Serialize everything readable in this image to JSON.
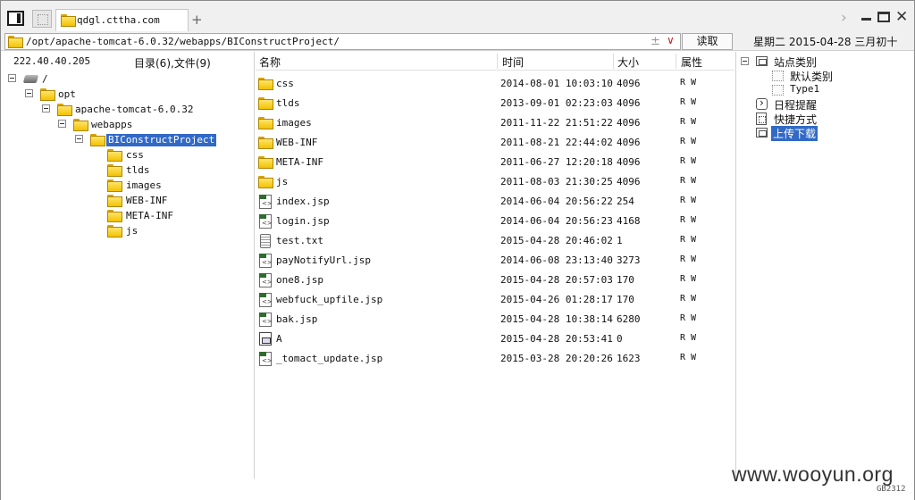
{
  "tab": {
    "title": "qdgl.cttha.com",
    "new_tab": "+"
  },
  "window_controls": {
    "forward": "›",
    "close": "✕"
  },
  "address": {
    "path": "/opt/apache-tomcat-6.0.32/webapps/BIConstructProject/",
    "star": "±",
    "dropdown": "∨"
  },
  "read_button": "读取",
  "date": "星期二 2015-04-28 三月初十",
  "tree": {
    "ip": "222.40.40.205",
    "counts": "目录(6),文件(9)",
    "nodes": [
      {
        "label": "/",
        "icon": "hdd-icon"
      },
      {
        "label": "opt",
        "icon": "folder-icon"
      },
      {
        "label": "apache-tomcat-6.0.32",
        "icon": "folder-icon"
      },
      {
        "label": "webapps",
        "icon": "folder-icon"
      },
      {
        "label": "BIConstructProject",
        "icon": "folder-icon",
        "selected": true
      },
      {
        "label": "css",
        "icon": "folder-icon"
      },
      {
        "label": "tlds",
        "icon": "folder-icon"
      },
      {
        "label": "images",
        "icon": "folder-icon"
      },
      {
        "label": "WEB-INF",
        "icon": "folder-icon"
      },
      {
        "label": "META-INF",
        "icon": "folder-icon"
      },
      {
        "label": "js",
        "icon": "folder-icon"
      }
    ]
  },
  "list": {
    "headers": {
      "name": "名称",
      "time": "时间",
      "size": "大小",
      "attr": "属性"
    },
    "rows": [
      {
        "name": "css",
        "time": "2014-08-01 10:03:10",
        "size": "4096",
        "attr": "R W",
        "icon": "folder-icon"
      },
      {
        "name": "tlds",
        "time": "2013-09-01 02:23:03",
        "size": "4096",
        "attr": "R W",
        "icon": "folder-icon"
      },
      {
        "name": "images",
        "time": "2011-11-22 21:51:22",
        "size": "4096",
        "attr": "R W",
        "icon": "folder-icon"
      },
      {
        "name": "WEB-INF",
        "time": "2011-08-21 22:44:02",
        "size": "4096",
        "attr": "R W",
        "icon": "folder-icon"
      },
      {
        "name": "META-INF",
        "time": "2011-06-27 12:20:18",
        "size": "4096",
        "attr": "R W",
        "icon": "folder-icon"
      },
      {
        "name": "js",
        "time": "2011-08-03 21:30:25",
        "size": "4096",
        "attr": "R W",
        "icon": "folder-icon"
      },
      {
        "name": "index.jsp",
        "time": "2014-06-04 20:56:22",
        "size": "254",
        "attr": "R W",
        "icon": "jsp-file-icon"
      },
      {
        "name": "login.jsp",
        "time": "2014-06-04 20:56:23",
        "size": "4168",
        "attr": "R W",
        "icon": "jsp-file-icon"
      },
      {
        "name": "test.txt",
        "time": "2015-04-28 20:46:02",
        "size": "1",
        "attr": "R W",
        "icon": "text-file-icon"
      },
      {
        "name": "payNotifyUrl.jsp",
        "time": "2014-06-08 23:13:40",
        "size": "3273",
        "attr": "R W",
        "icon": "jsp-file-icon"
      },
      {
        "name": "one8.jsp",
        "time": "2015-04-28 20:57:03",
        "size": "170",
        "attr": "R W",
        "icon": "jsp-file-icon"
      },
      {
        "name": "webfuck_upfile.jsp",
        "time": "2015-04-26 01:28:17",
        "size": "170",
        "attr": "R W",
        "icon": "jsp-file-icon"
      },
      {
        "name": "bak.jsp",
        "time": "2015-04-28 10:38:14",
        "size": "6280",
        "attr": "R W",
        "icon": "jsp-file-icon"
      },
      {
        "name": "A",
        "time": "2015-04-28 20:53:41",
        "size": "0",
        "attr": "R W",
        "icon": "binary-file-icon"
      },
      {
        "name": "_tomact_update.jsp",
        "time": "2015-03-28 20:20:26",
        "size": "1623",
        "attr": "R W",
        "icon": "jsp-file-icon"
      }
    ]
  },
  "sidebar": {
    "items": [
      {
        "label": "站点类别",
        "icon": "category-icon"
      },
      {
        "label": "默认类别",
        "icon": "blank-icon"
      },
      {
        "label": "Type1",
        "icon": "blank-icon"
      },
      {
        "label": "日程提醒",
        "icon": "schedule-icon"
      },
      {
        "label": "快捷方式",
        "icon": "shortcut-icon"
      },
      {
        "label": "上传下载",
        "icon": "transfer-icon",
        "selected": true
      }
    ]
  },
  "watermark": "www.wooyun.org",
  "encoding": "GB2312"
}
